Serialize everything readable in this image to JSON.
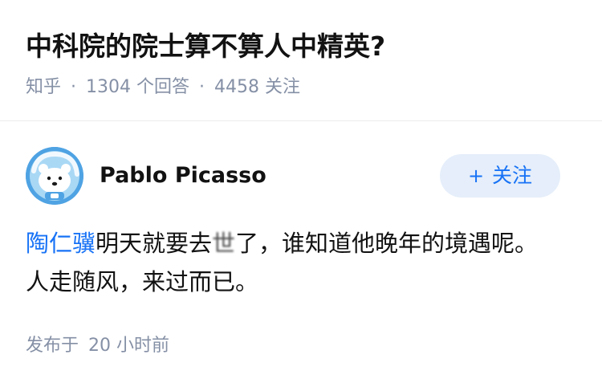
{
  "question": {
    "title": "中科院的院士算不算人中精英?",
    "source": "知乎",
    "separator": "·",
    "answer_count": "1304",
    "answer_unit": "个回答",
    "follower_count": "4458",
    "follower_unit": "关注"
  },
  "answer": {
    "author": {
      "name": "Pablo Picasso",
      "avatar_icon": "polar-bear-avatar-icon"
    },
    "follow_button": {
      "plus": "+",
      "label": "关注"
    },
    "content": {
      "mention": "陶仁骥",
      "text_1": "明天就要去",
      "text_blurred": "世",
      "text_2": "了，谁知道他晚年的境遇呢。",
      "line_2": "人走随风，来过而已。"
    },
    "published": {
      "prefix": "发布于",
      "time": "20 小时前"
    }
  },
  "colors": {
    "text_primary": "#121212",
    "text_secondary": "#8590a6",
    "link": "#1772f6",
    "follow_bg": "#e5eefa",
    "avatar_bg": "#4fa3e3"
  }
}
